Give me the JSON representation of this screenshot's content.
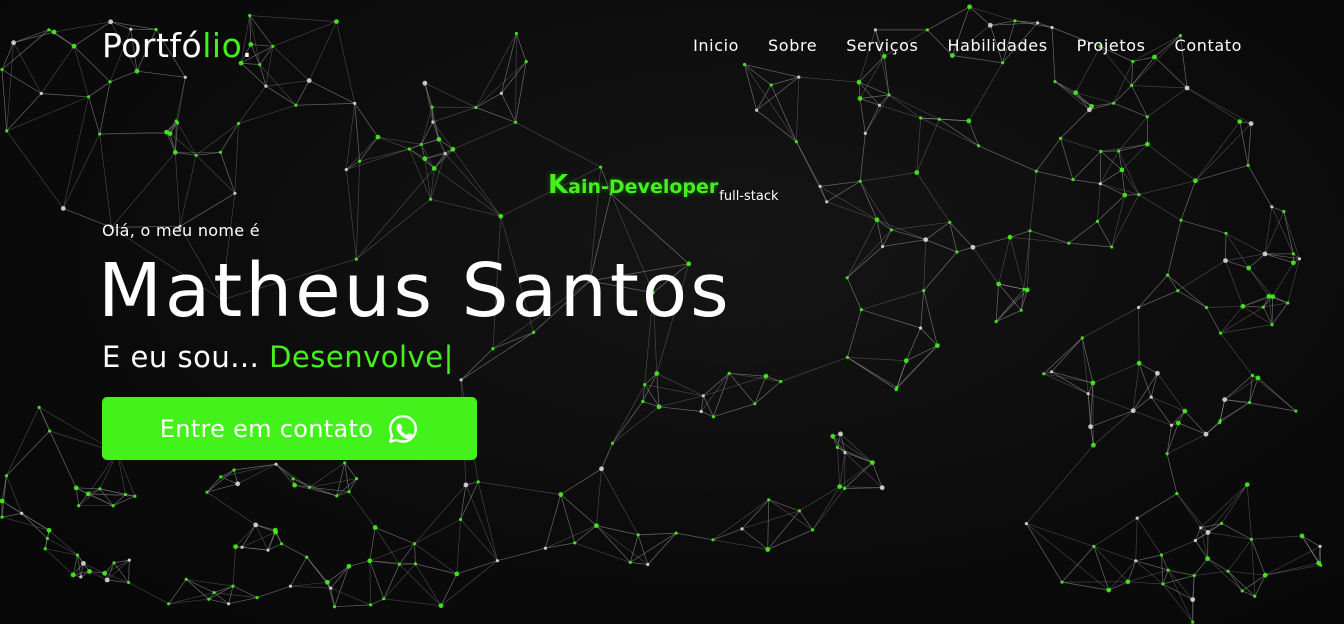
{
  "logo": {
    "text": "Portfó",
    "accent": "lio",
    "dot": "."
  },
  "nav": {
    "items": [
      {
        "label": "Inicio"
      },
      {
        "label": "Sobre"
      },
      {
        "label": "Serviços"
      },
      {
        "label": "Habilidades"
      },
      {
        "label": "Projetos"
      },
      {
        "label": "Contato"
      }
    ]
  },
  "tag": {
    "initial": "K",
    "rest": "ain-Developer",
    "sub": "full-stack"
  },
  "hero": {
    "greeting": "Olá, o meu nome é",
    "name": "Matheus Santos",
    "role_prefix": "E eu sou... ",
    "role_typed": "Desenvolve",
    "cursor": "|"
  },
  "cta": {
    "label": "Entre em contato",
    "icon": "whatsapp-icon"
  },
  "colors": {
    "accent": "#43f21a",
    "background": "#0b0b0b",
    "text": "#ffffff",
    "network_line": "#9a9a9a"
  }
}
